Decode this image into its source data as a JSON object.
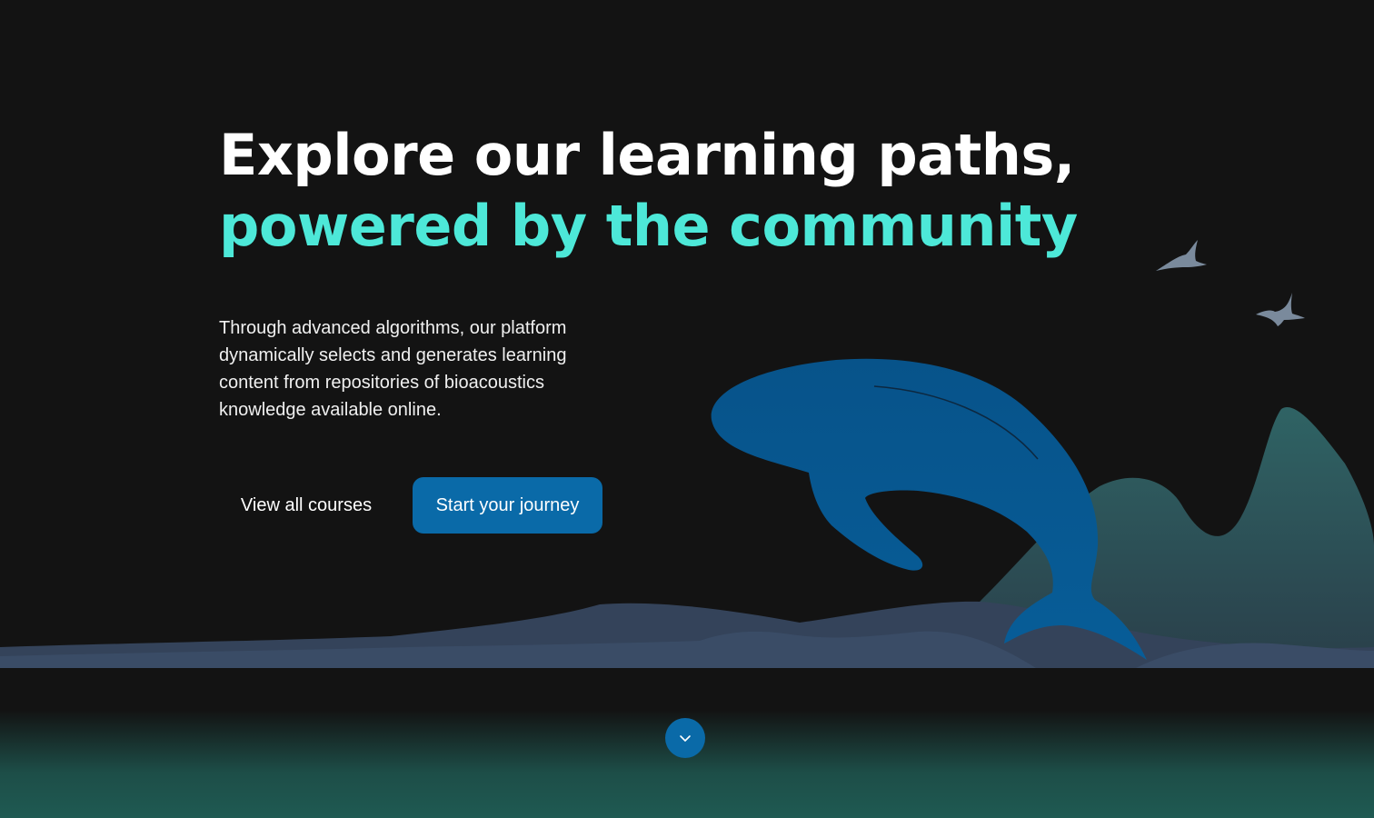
{
  "hero": {
    "headline_line1": "Explore our learning paths,",
    "headline_line2": "powered by the community",
    "description": "Through advanced algorithms, our platform dynamically selects and generates learning content from repositories of bioacoustics knowledge available online.",
    "secondary_button": "View all courses",
    "primary_button": "Start your journey"
  },
  "icons": {
    "scroll": "chevron-down-icon",
    "whale": "whale-illustration",
    "birds": "bird-icon"
  },
  "colors": {
    "background": "#131313",
    "headline_primary": "#ffffff",
    "headline_accent": "#4de8d8",
    "button_primary": "#0a6aa8",
    "whale": "#075a8c",
    "mountain": "#2e5a5c",
    "waves": "#3a4a60",
    "birds": "#7a8a9c"
  }
}
